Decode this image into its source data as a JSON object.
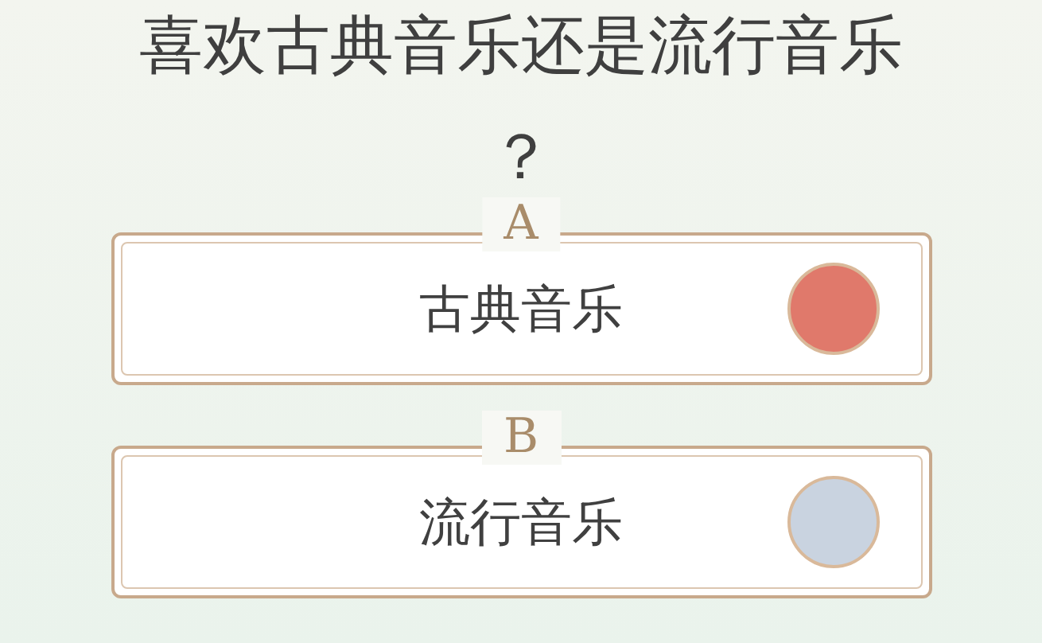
{
  "question": "喜欢古典音乐还是流行音乐？",
  "options": [
    {
      "letter": "A",
      "label": "古典音乐",
      "color": "#e0796b"
    },
    {
      "letter": "B",
      "label": "流行音乐",
      "color": "#c9d3e0"
    }
  ]
}
